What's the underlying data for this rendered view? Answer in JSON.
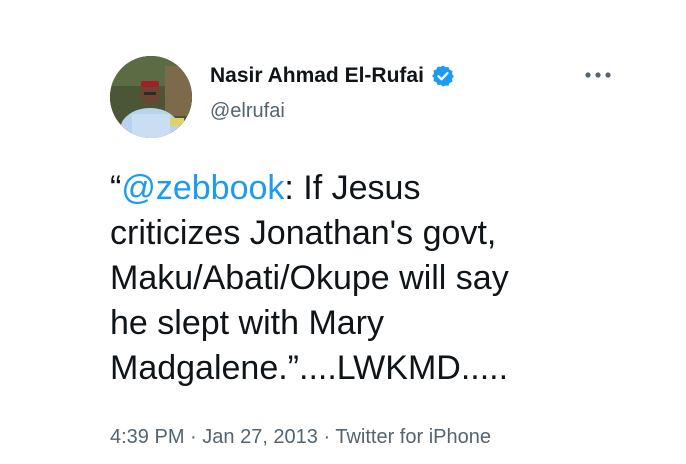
{
  "tweet": {
    "author_name": "Nasir Ahmad El-Rufai",
    "handle": "@elrufai",
    "verified": true,
    "more_label": "···",
    "text": {
      "open_quote": "“",
      "mention": "@zebbook",
      "line1_rest": ": If Jesus",
      "line2": "criticizes Jonathan's govt,",
      "line3": "Maku/Abati/Okupe will say",
      "line4": "he slept with Mary",
      "line5": "Madgalene.”....LWKMD....."
    },
    "meta": {
      "time": "4:39 PM",
      "separator": " · ",
      "date": "Jan 27, 2013",
      "source": "Twitter for iPhone"
    }
  },
  "colors": {
    "accent": "#1d9bf0",
    "text": "#0f1419",
    "muted": "#536471"
  },
  "icons": {
    "verified": "verified-badge-icon",
    "more": "more-dots-icon",
    "avatar": "profile-avatar"
  }
}
